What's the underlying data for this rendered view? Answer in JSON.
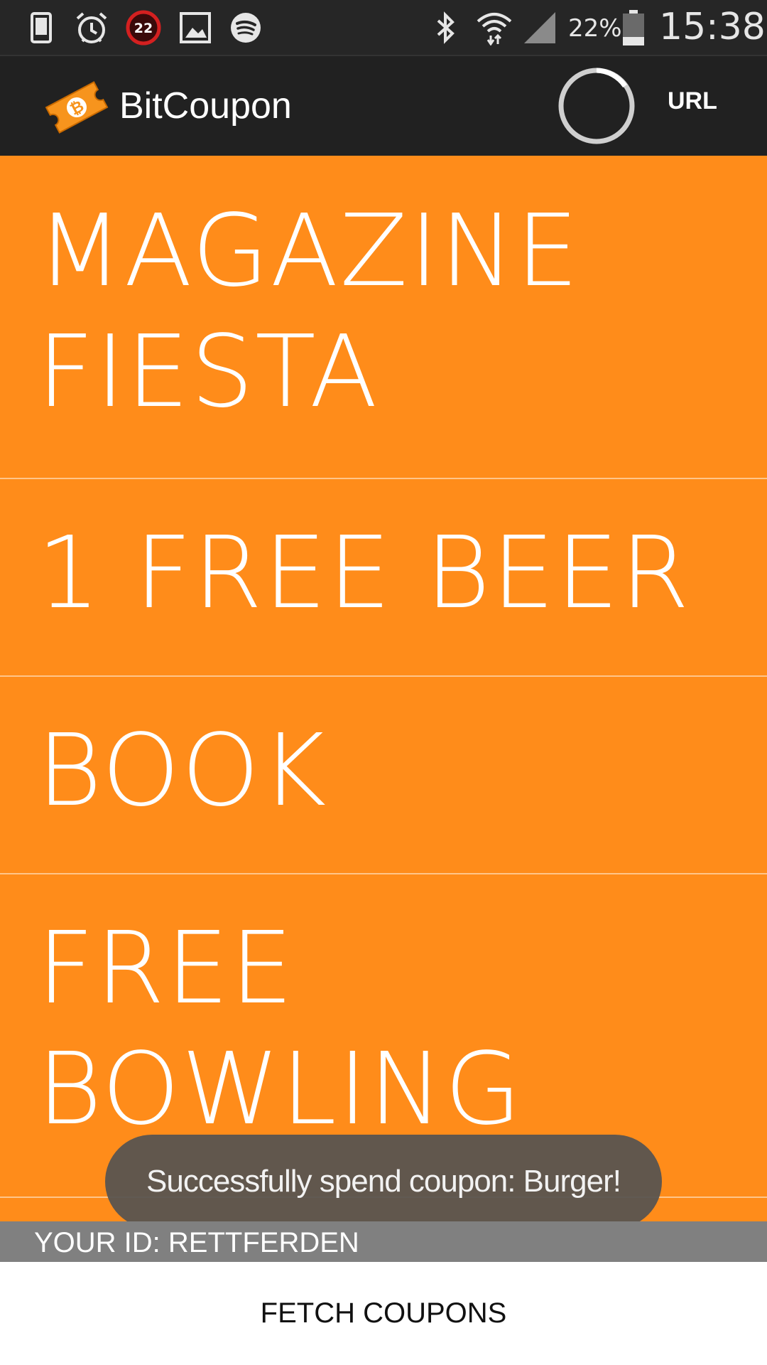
{
  "status_bar": {
    "icons_left": [
      "phone-icon",
      "alarm-icon",
      "notification-badge-icon",
      "image-icon",
      "spotify-icon"
    ],
    "badge_number": "22",
    "icons_right": [
      "bluetooth-icon",
      "wifi-icon",
      "cell-signal-icon",
      "battery-icon"
    ],
    "battery_percent": "22%",
    "time": "15:38"
  },
  "action_bar": {
    "app_title": "BitCoupon",
    "url_label": "URL",
    "logo_icon": "bitcoin-ticket-icon",
    "spinner_icon": "loading-spinner-icon"
  },
  "coupons": [
    {
      "label": "MAGAZINE FIESTA"
    },
    {
      "label": "1 FREE BEER"
    },
    {
      "label": "BOOK"
    },
    {
      "label": "FREE BOWLING"
    }
  ],
  "toast": {
    "message": "Successfully spend coupon: Burger!"
  },
  "footer": {
    "your_id": "YOUR ID: RETTFERDEN",
    "fetch_label": "FETCH COUPONS"
  },
  "colors": {
    "accent": "#ff8c1a",
    "action_bar": "#212121",
    "status_bar": "#262626",
    "id_strip": "#808080",
    "toast": "#585450"
  }
}
